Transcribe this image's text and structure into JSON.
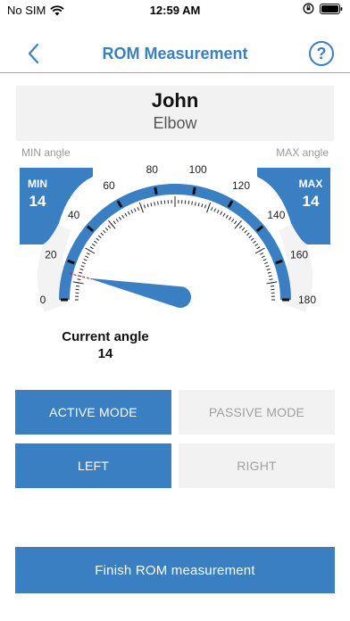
{
  "status_bar": {
    "carrier": "No SIM",
    "time": "12:59 AM"
  },
  "nav": {
    "title": "ROM Measurement",
    "help_glyph": "?",
    "back_icon": "chevron-left-icon",
    "help_icon": "question-circle-icon"
  },
  "patient": {
    "name": "John",
    "joint": "Elbow"
  },
  "gauge": {
    "min_angle_caption": "MIN angle",
    "max_angle_caption": "MAX angle",
    "min_title": "MIN",
    "min_value": 14,
    "max_title": "MAX",
    "max_value": 14,
    "scale_min": 0,
    "scale_max": 180,
    "tick_labels": [
      "0",
      "20",
      "40",
      "60",
      "80",
      "100",
      "120",
      "140",
      "160",
      "180"
    ],
    "needle_value": 14
  },
  "current": {
    "label": "Current angle",
    "value": "14"
  },
  "buttons": {
    "active_mode": "ACTIVE MODE",
    "passive_mode": "PASSIVE MODE",
    "left": "LEFT",
    "right": "RIGHT",
    "finish": "Finish ROM measurement"
  },
  "colors": {
    "accent": "#3a7fc2",
    "inactive_bg": "#f2f2f2",
    "inactive_text": "#a0a0a0"
  }
}
